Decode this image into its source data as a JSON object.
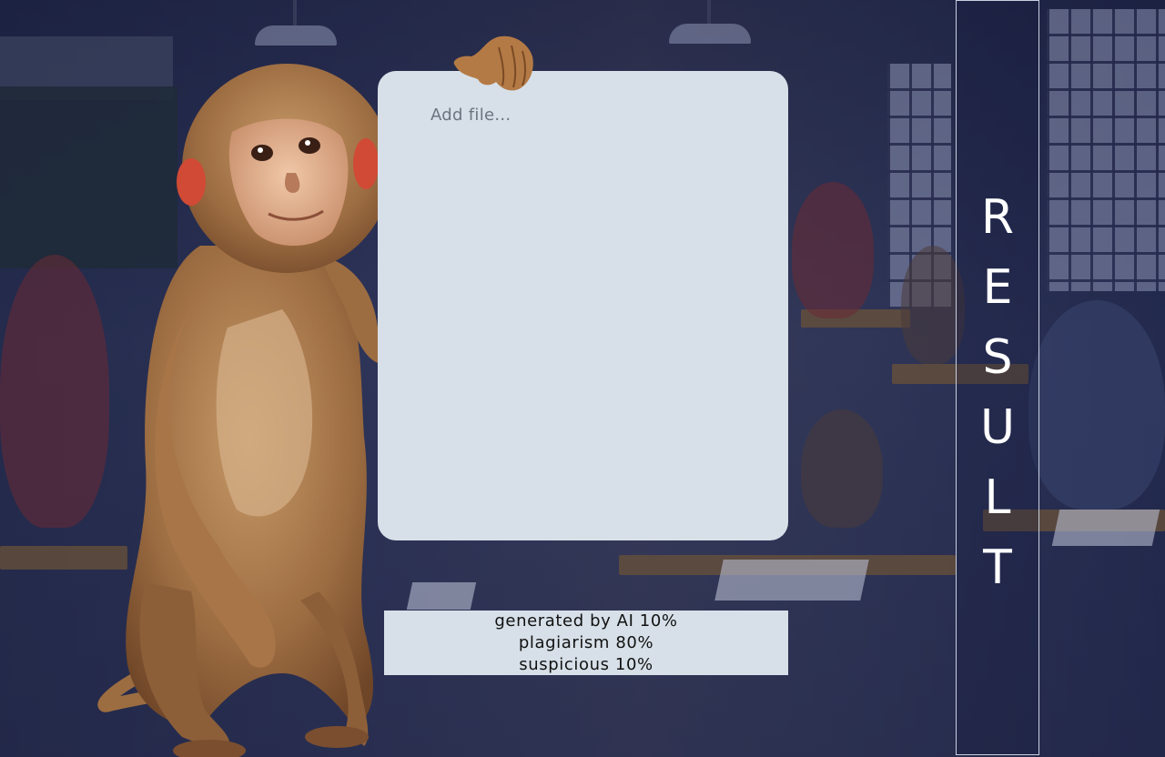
{
  "upload": {
    "placeholder_label": "Add file..."
  },
  "result_stats": {
    "lines": [
      "generated by AI 10%",
      "plagiarism 80%",
      "suspicious 10%"
    ]
  },
  "result_button": {
    "letters": [
      "R",
      "E",
      "S",
      "U",
      "L",
      "T"
    ]
  },
  "colors": {
    "panel_bg": "#d7e0e8",
    "placeholder_text": "#6b7480",
    "result_text": "#111111",
    "button_text": "#ffffff",
    "button_border": "#c9d0e0"
  }
}
